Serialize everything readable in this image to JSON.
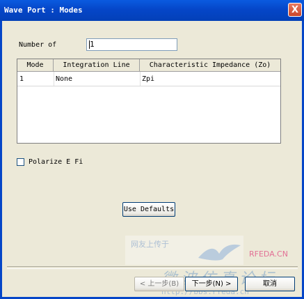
{
  "window": {
    "title": "Wave Port : Modes",
    "close_glyph": "X"
  },
  "form": {
    "number_of_label": "Number of",
    "number_of_value": "1",
    "polarize_label": "Polarize E Fi",
    "use_defaults_label": "Use Defaults"
  },
  "table": {
    "headers": [
      "Mode",
      "Integration Line",
      "Characteristic Impedance (Zo)"
    ],
    "rows": [
      [
        "1",
        "None",
        "Zpi"
      ]
    ]
  },
  "footer": {
    "back_label": "< 上一步(B)",
    "next_label": "下一步(N) >",
    "cancel_label": "取消"
  },
  "watermark": {
    "top_left": "网友上传于",
    "brand": "RFEDA.CN",
    "slogan": "微波仿真论坛",
    "url": "http://bbs.rfeda.cn"
  },
  "colors": {
    "titlebar": "#0546c8",
    "dialog_bg": "#ece9d8",
    "close_button": "#c8452a",
    "watermark_brand": "#e05a8a"
  }
}
